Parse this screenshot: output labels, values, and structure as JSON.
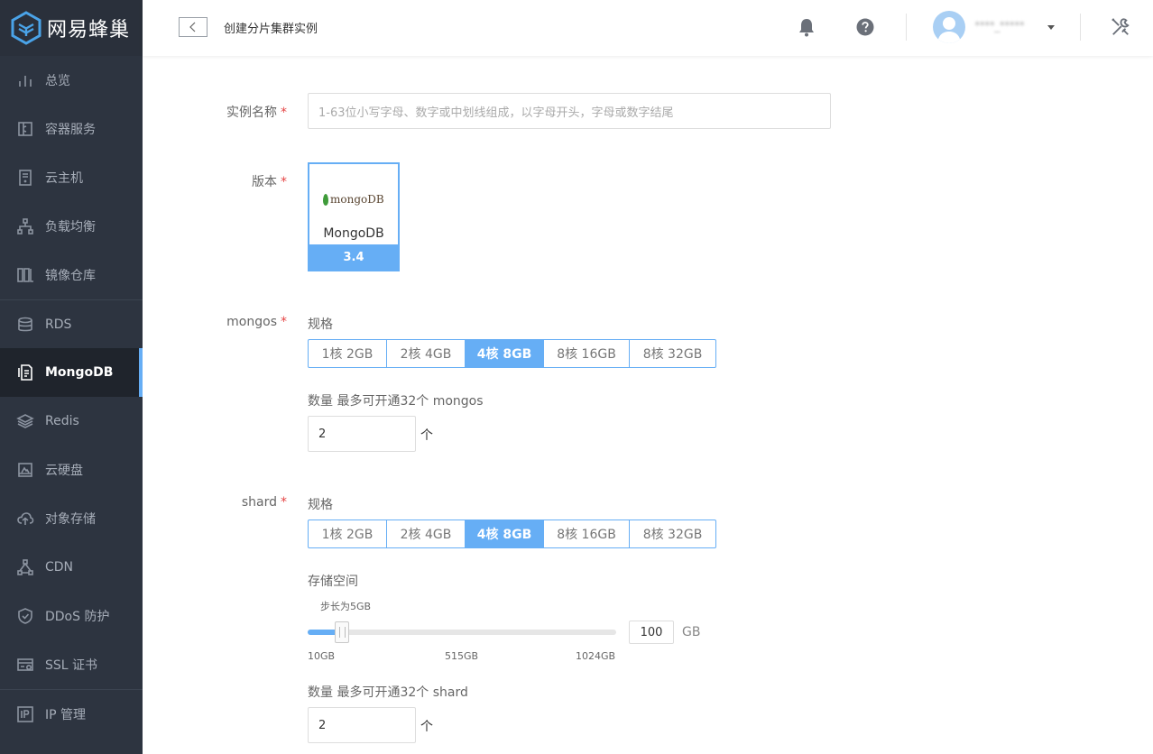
{
  "app": {
    "name": "网易蜂巢"
  },
  "sidebar": {
    "items": [
      {
        "label": "总览",
        "icon": "bar-chart-icon"
      },
      {
        "label": "容器服务",
        "icon": "container-icon"
      },
      {
        "label": "云主机",
        "icon": "server-icon"
      },
      {
        "label": "负载均衡",
        "icon": "load-balance-icon"
      },
      {
        "label": "镜像仓库",
        "icon": "image-repo-icon"
      },
      {
        "label": "RDS",
        "icon": "database-icon"
      },
      {
        "label": "MongoDB",
        "icon": "mongodb-icon"
      },
      {
        "label": "Redis",
        "icon": "redis-icon"
      },
      {
        "label": "云硬盘",
        "icon": "disk-icon"
      },
      {
        "label": "对象存储",
        "icon": "cloud-storage-icon"
      },
      {
        "label": "CDN",
        "icon": "cdn-icon"
      },
      {
        "label": "DDoS 防护",
        "icon": "shield-icon"
      },
      {
        "label": "SSL 证书",
        "icon": "certificate-icon"
      },
      {
        "label": "IP 管理",
        "icon": "ip-icon"
      }
    ],
    "active": "MongoDB",
    "accent": "#66aef5"
  },
  "header": {
    "title": "创建分片集群实例",
    "username": "****_*****"
  },
  "form": {
    "name": {
      "label": "实例名称",
      "placeholder": "1-63位小写字母、数字或中划线组成，以字母开头，字母或数字结尾"
    },
    "version": {
      "label": "版本",
      "logo_text": "mongoDB",
      "name": "MongoDB",
      "number": "3.4"
    },
    "mongos": {
      "label": "mongos",
      "spec_label": "规格",
      "options": [
        "1核 2GB",
        "2核 4GB",
        "4核 8GB",
        "8核 16GB",
        "8核 32GB"
      ],
      "selected": "4核 8GB",
      "count_label": "数量  最多可开通32个 mongos",
      "count_value": "2",
      "count_unit": "个"
    },
    "shard": {
      "label": "shard",
      "spec_label": "规格",
      "options": [
        "1核 2GB",
        "2核 4GB",
        "4核 8GB",
        "8核 16GB",
        "8核 32GB"
      ],
      "selected": "4核 8GB",
      "storage_label": "存储空间",
      "step_text": "步长为5GB",
      "storage_value": "100",
      "storage_min": 10,
      "storage_max": 1024,
      "storage_unit": "GB",
      "ticks": [
        "10GB",
        "515GB",
        "1024GB"
      ],
      "count_label": "数量  最多可开通32个 shard",
      "count_value": "2",
      "count_unit": "个"
    }
  }
}
